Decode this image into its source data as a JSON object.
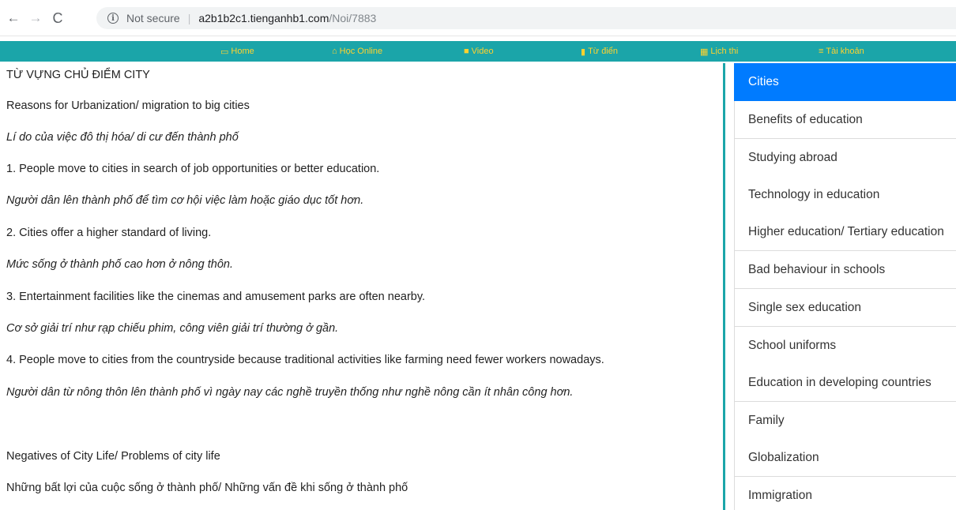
{
  "browser": {
    "back_icon": "←",
    "forward_icon": "→",
    "reload_icon": "C",
    "info_icon": "i",
    "security_label": "Not secure",
    "separator": "|",
    "url_host": "a2b1b2c1.tienganhb1.com",
    "url_path": "/Noi/7883"
  },
  "nav": {
    "items": [
      {
        "icon": "▭",
        "label": "Home"
      },
      {
        "icon": "⌂",
        "label": "Học Online"
      },
      {
        "icon": "■",
        "label": "Video"
      },
      {
        "icon": "▮",
        "label": "Từ điển"
      },
      {
        "icon": "▦",
        "label": "Lịch thi"
      },
      {
        "icon": "≡",
        "label": "Tài khoản"
      }
    ],
    "bg_color": "#1ba5a9",
    "text_color": "#ffd22e"
  },
  "content": {
    "title": "TỪ VỰNG CHỦ ĐIỂM CITY",
    "section1_heading_en": "Reasons for Urbanization/ migration to big cities",
    "section1_heading_vi": "Lí do của việc đô thị hóa/ di cư đến thành phố",
    "items": [
      {
        "en": "1. People move to cities in search of job opportunities or better education.",
        "vi": "Người dân lên thành phố để tìm cơ hội việc làm hoặc giáo dục tốt hơn."
      },
      {
        "en": "2. Cities offer a higher standard of living.",
        "vi": "Mức sống ở thành phố cao hơn ở nông thôn."
      },
      {
        "en": "3. Entertainment facilities like the cinemas and amusement parks are often nearby.",
        "vi": "Cơ sở giải trí như rạp chiếu phim, công viên giải trí thường ở gần."
      },
      {
        "en": "4. People move to cities from the countryside because traditional activities like farming need fewer workers nowadays.",
        "vi": "Người dân từ nông thôn lên thành phố vì ngày nay các nghề truyền thống như nghề nông cần ít nhân công hơn."
      }
    ],
    "section2_heading_en": "Negatives of City Life/ Problems of city life",
    "section2_heading_vi": "Những bất lợi của cuộc sống ở thành phố/ Những vấn đề khi sống ở thành phố"
  },
  "sidebar": {
    "items": [
      {
        "label": "Cities",
        "active": true
      },
      {
        "label": "Benefits of education"
      },
      {
        "label": "Studying abroad"
      },
      {
        "label": "Technology in education"
      },
      {
        "label": "Higher education/ Tertiary education"
      },
      {
        "label": "Bad behaviour in schools"
      },
      {
        "label": "Single sex education"
      },
      {
        "label": "School uniforms"
      },
      {
        "label": "Education in developing countries"
      },
      {
        "label": "Family"
      },
      {
        "label": "Globalization"
      },
      {
        "label": "Immigration"
      }
    ],
    "active_color": "#007bff"
  }
}
